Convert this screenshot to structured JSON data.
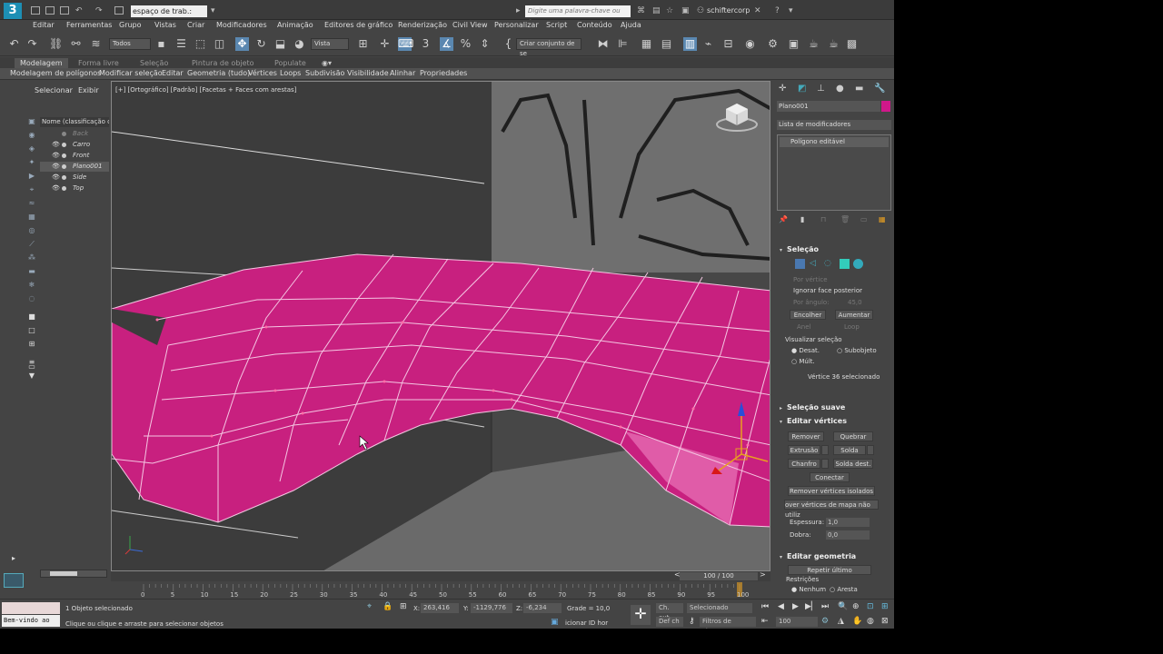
{
  "title_bar": {
    "logo": "3",
    "workspace": "espaço de trab.: padrã",
    "search_placeholder": "Digite uma palavra-chave ou frase",
    "user": "schiftercorp"
  },
  "menu": [
    "Editar",
    "Ferramentas",
    "Grupo",
    "Vistas",
    "Criar",
    "Modificadores",
    "Animação",
    "Editores de gráfico",
    "Renderização",
    "Civil View",
    "Personalizar",
    "Script",
    "Conteúdo",
    "Ajuda"
  ],
  "toolbar": {
    "filter": "Todos",
    "reference": "Vista",
    "selection_set": "Criar conjunto de se"
  },
  "ribbon": {
    "tabs": [
      "Modelagem",
      "Forma livre",
      "Seleção",
      "Pintura de objeto",
      "Populate"
    ],
    "items": [
      "Modelagem de polígonos",
      "Modificar seleção",
      "Editar",
      "Geometria (tudo)",
      "Vértices",
      "Loops",
      "Subdivisão",
      "Visibilidade",
      "Alinhar",
      "Propriedades"
    ]
  },
  "explorer": {
    "tab_select": "Selecionar",
    "tab_display": "Exibir",
    "header": "Nome (classificação cres",
    "objects": [
      {
        "name": "Back",
        "visible": false
      },
      {
        "name": "Carro",
        "visible": true
      },
      {
        "name": "Front",
        "visible": true
      },
      {
        "name": "Plano001",
        "visible": true
      },
      {
        "name": "Side",
        "visible": true
      },
      {
        "name": "Top",
        "visible": true
      }
    ]
  },
  "viewport": {
    "label": "[+] [Ortográfico] [Padrão] [Facetas + Faces com arestas]",
    "mesh_color": "#c8207f"
  },
  "command_panel": {
    "object_name": "Plano001",
    "object_color": "#d0188a",
    "modifier_list": "Lista de modificadores",
    "stack_item": "Polígono editável",
    "selection": {
      "title": "Seleção",
      "by_vertex": "Por vértice",
      "ignore_backfacing": "Ignorar face posterior",
      "by_angle_label": "Por ângulo:",
      "by_angle_value": "45,0",
      "shrink": "Encolher",
      "grow": "Aumentar",
      "ring": "Anel",
      "loop": "Loop",
      "preview_label": "Visualizar seleção",
      "preview_off": "Desat.",
      "preview_subobject": "Subobjeto",
      "preview_multi": "Múlt.",
      "status": "Vértice 36 selecionado"
    },
    "soft_selection_title": "Seleção suave",
    "edit_vertices": {
      "title": "Editar vértices",
      "remove": "Remover",
      "break": "Quebrar",
      "extrude": "Extrusão",
      "weld": "Solda",
      "chamfer": "Chanfro",
      "target_weld": "Solda dest.",
      "connect": "Conectar",
      "remove_isolated": "Remover vértices isolados",
      "remove_unused_map": "over vértices de mapa não utiliz",
      "weight_label": "Espessura:",
      "weight_value": "1,0",
      "crease_label": "Dobra:",
      "crease_value": "0,0"
    },
    "edit_geometry": {
      "title": "Editar geometria",
      "repeat_last": "Repetir último",
      "constraints": "Restrições",
      "none": "Nenhum",
      "edge": "Aresta"
    }
  },
  "timeline": {
    "frame": "100 / 100",
    "ticks": [
      "0",
      "5",
      "10",
      "15",
      "20",
      "25",
      "30",
      "35",
      "40",
      "45",
      "50",
      "55",
      "60",
      "65",
      "70",
      "75",
      "80",
      "85",
      "90",
      "95",
      "100"
    ]
  },
  "status": {
    "maxscript": "Bem-vindo ao",
    "selected": "1 Objeto selecionado",
    "prompt": "Clique ou clique e arraste para selecionar objetos",
    "x_label": "X:",
    "x": "263,416",
    "y_label": "Y:",
    "y": "-1129,776",
    "z_label": "Z:",
    "z": "-6,234",
    "grid": "Grade = 10,0",
    "add_time_tag": "icionar ID hor",
    "auto_key": "Ch. aut.",
    "set_key": "Def ch",
    "selected_dd": "Selecionado",
    "key_filters": "Filtros de chave...",
    "frame_field": "100"
  }
}
